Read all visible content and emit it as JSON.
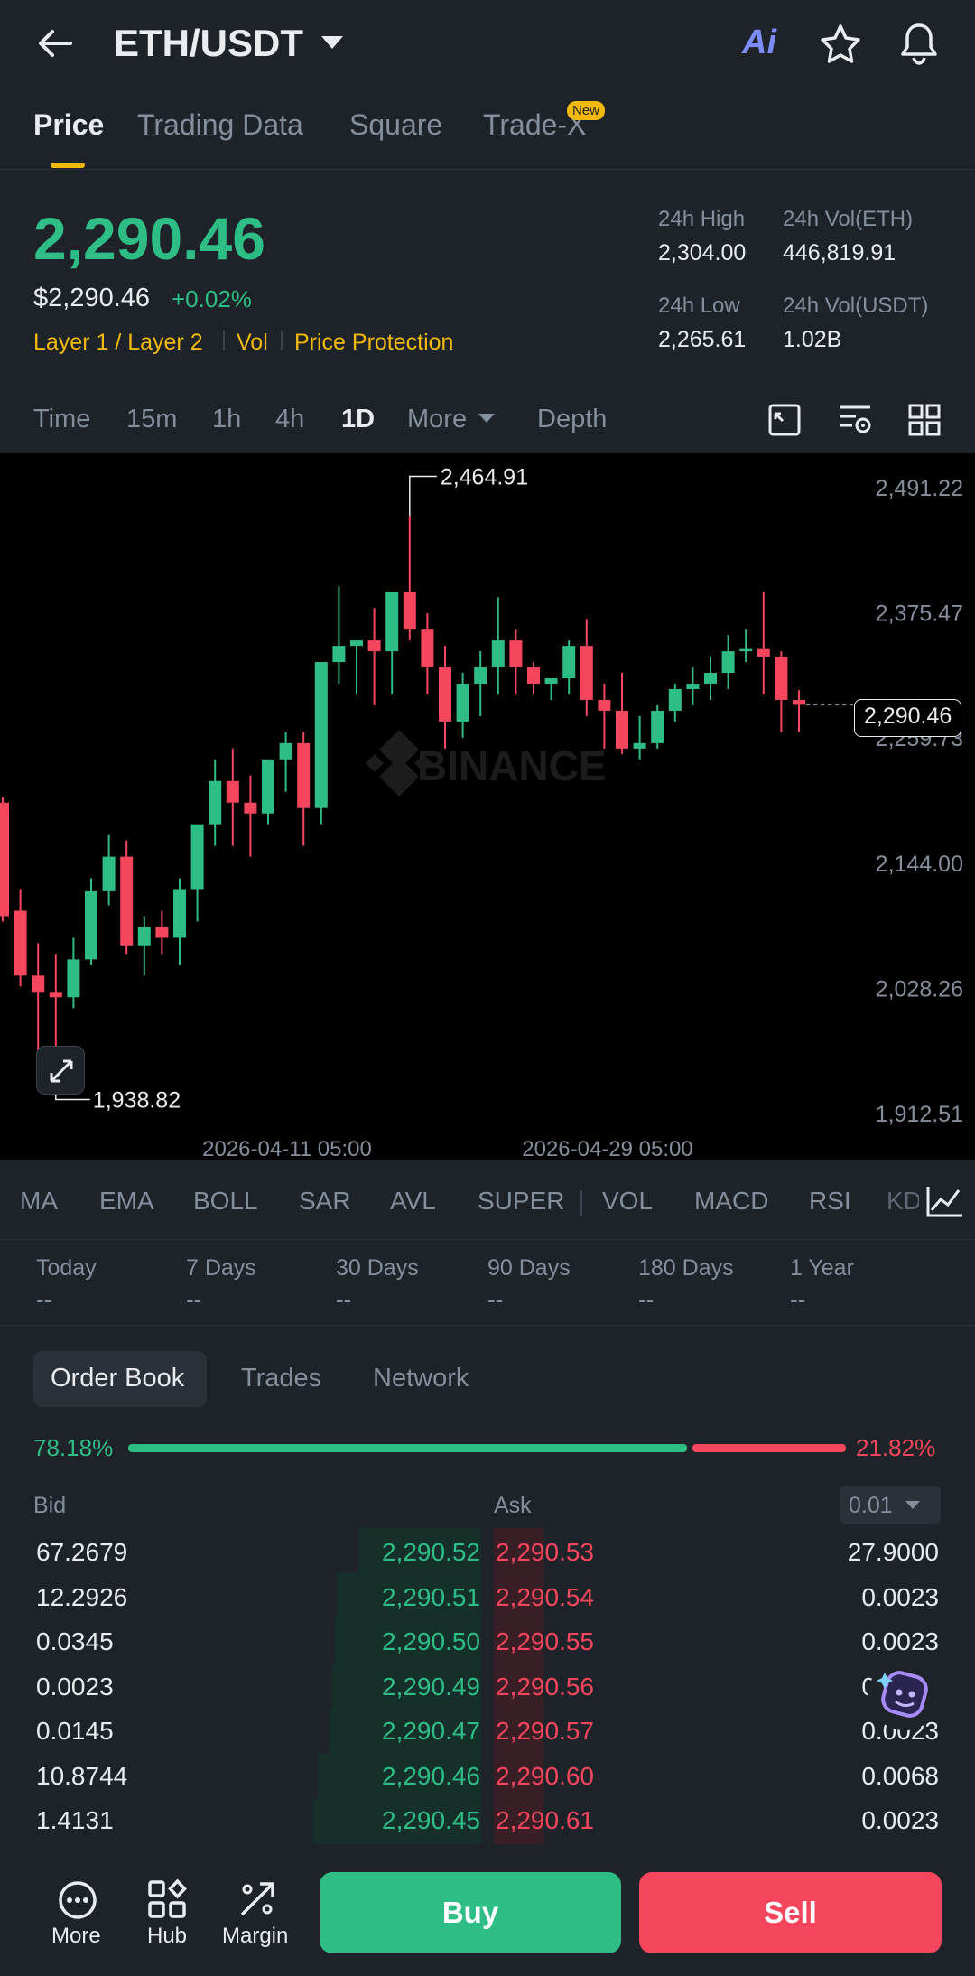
{
  "header": {
    "pair": "ETH/USDT",
    "ai_label": "Ai"
  },
  "tabs": [
    {
      "label": "Price"
    },
    {
      "label": "Trading Data"
    },
    {
      "label": "Square"
    },
    {
      "label": "Trade-X",
      "badge": "New"
    }
  ],
  "ticker": {
    "last": "2,290.46",
    "usd": "$2,290.46",
    "change": "+0.02%",
    "tags": [
      "Layer 1 / Layer 2",
      "Vol",
      "Price Protection"
    ],
    "high_label": "24h High",
    "high": "2,304.00",
    "vol_eth_label": "24h Vol(ETH)",
    "vol_eth": "446,819.91",
    "low_label": "24h Low",
    "low": "2,265.61",
    "vol_usdt_label": "24h Vol(USDT)",
    "vol_usdt": "1.02B"
  },
  "timeframes": [
    "Time",
    "15m",
    "1h",
    "4h",
    "1D",
    "More",
    "Depth"
  ],
  "chart": {
    "watermark": "BINANCE",
    "current_price": "2,290.46",
    "high_mark": "2,464.91",
    "low_mark": "1,938.82"
  },
  "chart_data": {
    "type": "candlestick",
    "y_ticks": [
      "2,491.22",
      "2,375.47",
      "2,259.73",
      "2,144.00",
      "2,028.26",
      "1,912.51"
    ],
    "ylim": [
      1912.51,
      2491.22
    ],
    "x_ticks": [
      "2026-04-11 05:00",
      "2026-04-29 05:00"
    ],
    "candles": [
      {
        "o": 2200,
        "h": 2205,
        "l": 2090,
        "c": 2095
      },
      {
        "o": 2100,
        "h": 2120,
        "l": 2030,
        "c": 2040
      },
      {
        "o": 2040,
        "h": 2070,
        "l": 1945,
        "c": 2025
      },
      {
        "o": 2025,
        "h": 2060,
        "l": 1938.82,
        "c": 2020
      },
      {
        "o": 2020,
        "h": 2075,
        "l": 2010,
        "c": 2055
      },
      {
        "o": 2055,
        "h": 2130,
        "l": 2050,
        "c": 2118
      },
      {
        "o": 2118,
        "h": 2170,
        "l": 2105,
        "c": 2150
      },
      {
        "o": 2150,
        "h": 2165,
        "l": 2060,
        "c": 2068
      },
      {
        "o": 2068,
        "h": 2095,
        "l": 2040,
        "c": 2085
      },
      {
        "o": 2085,
        "h": 2100,
        "l": 2060,
        "c": 2075
      },
      {
        "o": 2075,
        "h": 2130,
        "l": 2050,
        "c": 2120
      },
      {
        "o": 2120,
        "h": 2180,
        "l": 2090,
        "c": 2180
      },
      {
        "o": 2180,
        "h": 2240,
        "l": 2160,
        "c": 2220
      },
      {
        "o": 2220,
        "h": 2250,
        "l": 2160,
        "c": 2200
      },
      {
        "o": 2200,
        "h": 2225,
        "l": 2150,
        "c": 2190
      },
      {
        "o": 2190,
        "h": 2240,
        "l": 2180,
        "c": 2240
      },
      {
        "o": 2240,
        "h": 2265,
        "l": 2210,
        "c": 2255
      },
      {
        "o": 2255,
        "h": 2265,
        "l": 2160,
        "c": 2195
      },
      {
        "o": 2195,
        "h": 2330,
        "l": 2180,
        "c": 2330
      },
      {
        "o": 2330,
        "h": 2400,
        "l": 2310,
        "c": 2345
      },
      {
        "o": 2345,
        "h": 2350,
        "l": 2300,
        "c": 2350
      },
      {
        "o": 2350,
        "h": 2380,
        "l": 2290,
        "c": 2340
      },
      {
        "o": 2340,
        "h": 2390,
        "l": 2300,
        "c": 2395
      },
      {
        "o": 2395,
        "h": 2464.91,
        "l": 2350,
        "c": 2360
      },
      {
        "o": 2360,
        "h": 2375,
        "l": 2300,
        "c": 2325
      },
      {
        "o": 2325,
        "h": 2345,
        "l": 2250,
        "c": 2275
      },
      {
        "o": 2275,
        "h": 2320,
        "l": 2260,
        "c": 2310
      },
      {
        "o": 2310,
        "h": 2340,
        "l": 2280,
        "c": 2325
      },
      {
        "o": 2325,
        "h": 2390,
        "l": 2300,
        "c": 2350
      },
      {
        "o": 2350,
        "h": 2360,
        "l": 2300,
        "c": 2325
      },
      {
        "o": 2325,
        "h": 2330,
        "l": 2300,
        "c": 2310
      },
      {
        "o": 2310,
        "h": 2315,
        "l": 2295,
        "c": 2315
      },
      {
        "o": 2315,
        "h": 2350,
        "l": 2300,
        "c": 2345
      },
      {
        "o": 2345,
        "h": 2370,
        "l": 2280,
        "c": 2295
      },
      {
        "o": 2295,
        "h": 2310,
        "l": 2250,
        "c": 2285
      },
      {
        "o": 2285,
        "h": 2320,
        "l": 2245,
        "c": 2250
      },
      {
        "o": 2250,
        "h": 2280,
        "l": 2240,
        "c": 2255
      },
      {
        "o": 2255,
        "h": 2290,
        "l": 2250,
        "c": 2285
      },
      {
        "o": 2285,
        "h": 2310,
        "l": 2275,
        "c": 2305
      },
      {
        "o": 2305,
        "h": 2325,
        "l": 2290,
        "c": 2310
      },
      {
        "o": 2310,
        "h": 2335,
        "l": 2295,
        "c": 2320
      },
      {
        "o": 2320,
        "h": 2355,
        "l": 2305,
        "c": 2340
      },
      {
        "o": 2340,
        "h": 2360,
        "l": 2330,
        "c": 2342
      },
      {
        "o": 2342,
        "h": 2395,
        "l": 2300,
        "c": 2335
      },
      {
        "o": 2335,
        "h": 2340,
        "l": 2265,
        "c": 2295
      },
      {
        "o": 2295,
        "h": 2304,
        "l": 2265.61,
        "c": 2290.46
      }
    ]
  },
  "indicators": [
    "MA",
    "EMA",
    "BOLL",
    "SAR",
    "AVL",
    "SUPER",
    "VOL",
    "MACD",
    "RSI",
    "KD"
  ],
  "periods": [
    {
      "label": "Today",
      "value": "--"
    },
    {
      "label": "7 Days",
      "value": "--"
    },
    {
      "label": "30 Days",
      "value": "--"
    },
    {
      "label": "90 Days",
      "value": "--"
    },
    {
      "label": "180 Days",
      "value": "--"
    },
    {
      "label": "1 Year",
      "value": "--"
    }
  ],
  "book_tabs": [
    "Order Book",
    "Trades",
    "Network"
  ],
  "ratio": {
    "bid_pct": "78.18%",
    "ask_pct": "21.82%",
    "bid_frac": 0.7818
  },
  "book": {
    "bid_label": "Bid",
    "ask_label": "Ask",
    "precision": "0.01",
    "rows": [
      {
        "bid_qty": "67.2679",
        "bid_price": "2,290.52",
        "ask_price": "2,290.53",
        "ask_qty": "27.9000"
      },
      {
        "bid_qty": "12.2926",
        "bid_price": "2,290.51",
        "ask_price": "2,290.54",
        "ask_qty": "0.0023"
      },
      {
        "bid_qty": "0.0345",
        "bid_price": "2,290.50",
        "ask_price": "2,290.55",
        "ask_qty": "0.0023"
      },
      {
        "bid_qty": "0.0023",
        "bid_price": "2,290.49",
        "ask_price": "2,290.56",
        "ask_qty": "0.0023"
      },
      {
        "bid_qty": "0.0145",
        "bid_price": "2,290.47",
        "ask_price": "2,290.57",
        "ask_qty": "0.0023"
      },
      {
        "bid_qty": "10.8744",
        "bid_price": "2,290.46",
        "ask_price": "2,290.60",
        "ask_qty": "0.0068"
      },
      {
        "bid_qty": "1.4131",
        "bid_price": "2,290.45",
        "ask_price": "2,290.61",
        "ask_qty": "0.0023"
      }
    ]
  },
  "bottom": {
    "more": "More",
    "hub": "Hub",
    "margin": "Margin",
    "buy": "Buy",
    "sell": "Sell"
  },
  "colors": {
    "up": "#2ebd85",
    "down": "#f6465d",
    "accent": "#f0b90b",
    "bg": "#1e2329",
    "chart_bg": "#000000"
  }
}
